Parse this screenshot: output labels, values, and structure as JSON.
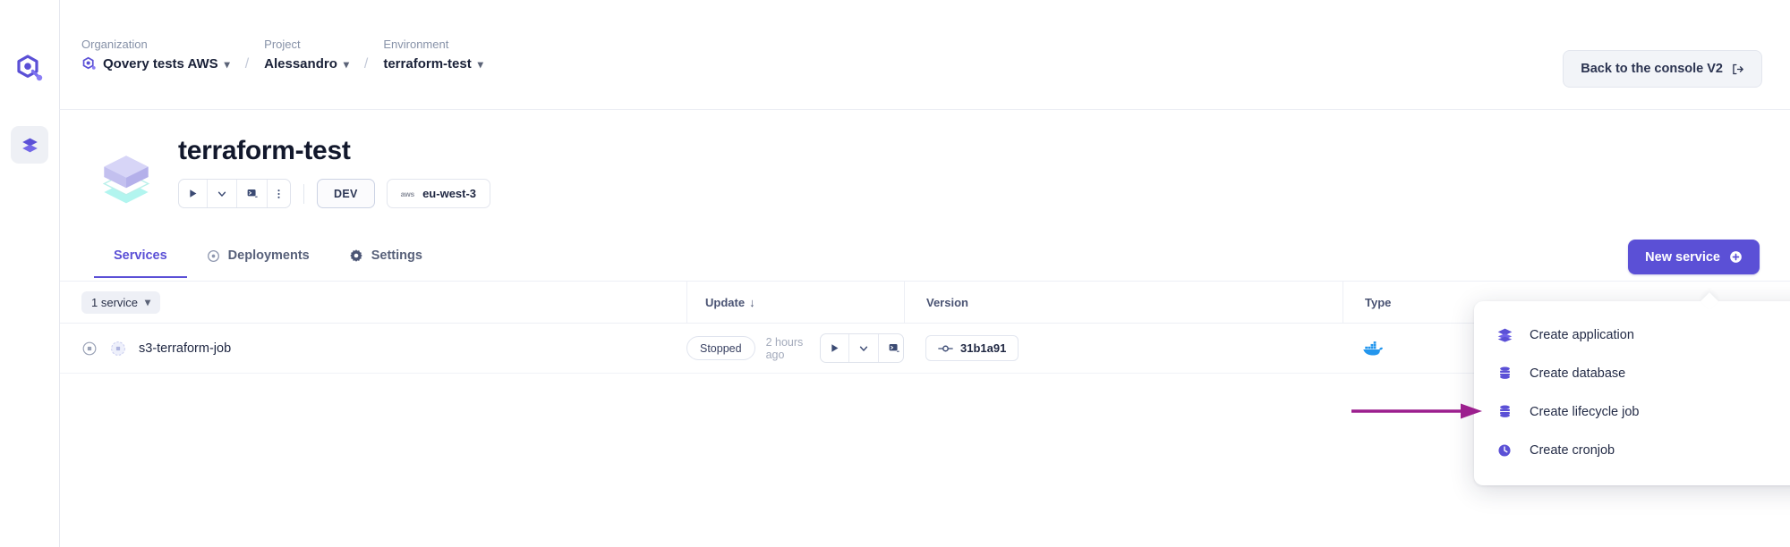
{
  "colors": {
    "brand": "#5b50d6",
    "arrow": "#9c1f8e",
    "docker_blue": "#2496ed",
    "muted": "#8792a8"
  },
  "rail": {
    "logo_icon": "qovery-logo-icon",
    "items": [
      {
        "icon": "layers-icon",
        "name": "environments"
      }
    ]
  },
  "topbar": {
    "breadcrumb": [
      {
        "label": "Organization",
        "value": "Qovery tests AWS",
        "icon": "qovery-org-icon",
        "chevron": "⌄"
      },
      {
        "label": "Project",
        "value": "Alessandro",
        "icon": "",
        "chevron": "⌄"
      },
      {
        "label": "Environment",
        "value": "terraform-test",
        "icon": "",
        "chevron": "⌄"
      }
    ],
    "separator": "/",
    "console_button": {
      "label": "Back to the console V2",
      "icon": "logout-icon"
    }
  },
  "env_header": {
    "icon": "environment-cube-icon",
    "title": "terraform-test",
    "actions": [
      {
        "icon": "play-icon",
        "name": "deploy-button"
      },
      {
        "icon": "chevron-down-icon",
        "name": "deploy-options-button"
      },
      {
        "icon": "terminal-icon",
        "name": "logs-button"
      },
      {
        "icon": "dots-vertical-icon",
        "name": "more-menu-button"
      }
    ],
    "mode_badge": "DEV",
    "region_badge": {
      "cloud": "aws",
      "region": "eu-west-3"
    }
  },
  "tabs": [
    {
      "label": "Services",
      "icon": "",
      "active": true
    },
    {
      "label": "Deployments",
      "icon": "target-icon",
      "active": false
    },
    {
      "label": "Settings",
      "icon": "gear-icon",
      "active": false
    }
  ],
  "new_service_button": {
    "label": "New service",
    "icon": "plus-circle-icon"
  },
  "table": {
    "count_chip": {
      "label": "1 service",
      "chevron": "⌄"
    },
    "headers": [
      {
        "key": "name",
        "label": ""
      },
      {
        "key": "update",
        "label": "Update",
        "sort": "↓"
      },
      {
        "key": "version",
        "label": "Version"
      },
      {
        "key": "type",
        "label": "Type"
      }
    ],
    "rows": [
      {
        "status_icon": "status-stopped-icon",
        "service_icon": "service-circle-icon",
        "name": "s3-terraform-job",
        "status": "Stopped",
        "updated": "2 hours ago",
        "actions": [
          {
            "icon": "play-icon",
            "name": "row-deploy-button"
          },
          {
            "icon": "chevron-down-icon",
            "name": "row-deploy-options-button"
          },
          {
            "icon": "terminal-icon",
            "name": "row-logs-button"
          },
          {
            "icon": "dots-vertical-icon",
            "name": "row-more-menu-button"
          }
        ],
        "version": "31b1a91",
        "version_icon": "commit-icon",
        "type_icon": "docker-icon"
      }
    ]
  },
  "create_menu": {
    "items": [
      {
        "label": "Create application",
        "icon": "layers-icon"
      },
      {
        "label": "Create database",
        "icon": "database-icon"
      },
      {
        "label": "Create lifecycle job",
        "icon": "database-icon"
      },
      {
        "label": "Create cronjob",
        "icon": "clock-icon"
      }
    ]
  },
  "annotation": {
    "type": "arrow",
    "points_to": "Create lifecycle job"
  }
}
